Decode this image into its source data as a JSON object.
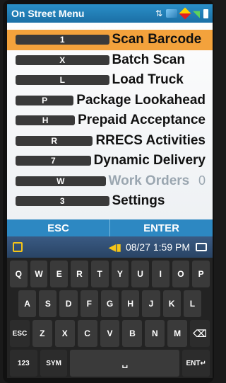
{
  "header": {
    "title": "On Street Menu"
  },
  "menu": {
    "items": [
      {
        "key": "1",
        "label": "Scan Barcode",
        "selected": true
      },
      {
        "key": "X",
        "label": "Batch Scan"
      },
      {
        "key": "L",
        "label": "Load Truck"
      },
      {
        "key": "P",
        "label": "Package Lookahead"
      },
      {
        "key": "H",
        "label": "Prepaid Acceptance"
      },
      {
        "key": "R",
        "label": "RRECS Activities"
      },
      {
        "key": "7",
        "label": "Dynamic Delivery"
      },
      {
        "key": "W",
        "label": "Work Orders",
        "count": "0",
        "disabled": true
      },
      {
        "key": "3",
        "label": "Settings"
      }
    ]
  },
  "softkeys": {
    "esc": "ESC",
    "enter": "ENTER"
  },
  "infobar": {
    "datetime": "08/27 1:59 PM"
  },
  "keyboard": {
    "row1": [
      "Q",
      "W",
      "E",
      "R",
      "T",
      "Y",
      "U",
      "I",
      "O",
      "P"
    ],
    "row2": [
      "A",
      "S",
      "D",
      "F",
      "G",
      "H",
      "J",
      "K",
      "L"
    ],
    "row3": [
      "ESC",
      "Z",
      "X",
      "C",
      "V",
      "B",
      "N",
      "M",
      "⌫"
    ],
    "row4": [
      "123",
      "SYM",
      "␣",
      "ENT↵"
    ]
  },
  "colors": {
    "accent": "#2d88c2",
    "selected": "#f3a23c"
  }
}
